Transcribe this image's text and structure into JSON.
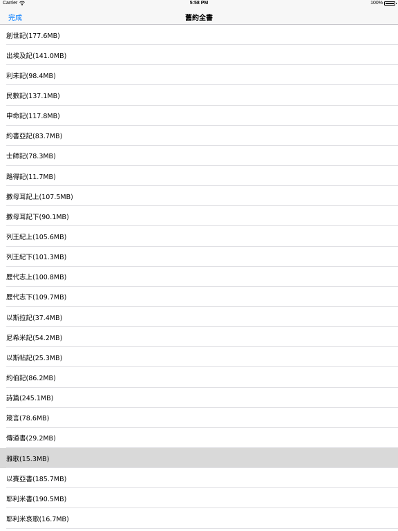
{
  "status_bar": {
    "carrier": "Carrier",
    "time": "5:58 PM",
    "battery": "100%",
    "battery_level": 1.0
  },
  "nav": {
    "done_label": "完成",
    "title": "舊約全書"
  },
  "list": {
    "selected_index": 21,
    "items": [
      {
        "label": "創世記(177.6MB)"
      },
      {
        "label": "出埃及記(141.0MB)"
      },
      {
        "label": "利未記(98.4MB)"
      },
      {
        "label": "民數記(137.1MB)"
      },
      {
        "label": "申命記(117.8MB)"
      },
      {
        "label": "約書亞記(83.7MB)"
      },
      {
        "label": "士師記(78.3MB)"
      },
      {
        "label": "路得記(11.7MB)"
      },
      {
        "label": "撒母耳記上(107.5MB)"
      },
      {
        "label": "撒母耳記下(90.1MB)"
      },
      {
        "label": "列王紀上(105.6MB)"
      },
      {
        "label": "列王紀下(101.3MB)"
      },
      {
        "label": "歷代志上(100.8MB)"
      },
      {
        "label": "歷代志下(109.7MB)"
      },
      {
        "label": "以斯拉記(37.4MB)"
      },
      {
        "label": "尼希米記(54.2MB)"
      },
      {
        "label": "以斯帖記(25.3MB)"
      },
      {
        "label": "約伯記(86.2MB)"
      },
      {
        "label": "詩篇(245.1MB)"
      },
      {
        "label": "箴言(78.6MB)"
      },
      {
        "label": "傳道書(29.2MB)"
      },
      {
        "label": "雅歌(15.3MB)"
      },
      {
        "label": "以賽亞書(185.7MB)"
      },
      {
        "label": "耶利米書(190.5MB)"
      },
      {
        "label": "耶利米哀歌(16.7MB)"
      }
    ]
  }
}
